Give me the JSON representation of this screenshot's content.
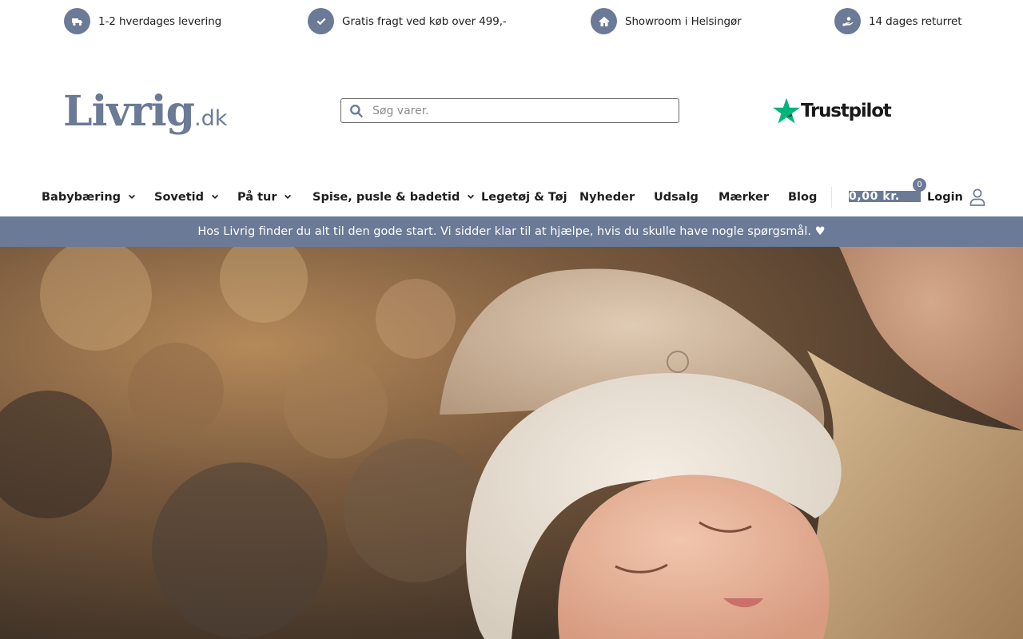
{
  "usp": [
    {
      "icon": "truck-icon",
      "text": "1-2 hverdages levering"
    },
    {
      "icon": "check-icon",
      "text": "Gratis fragt ved køb over 499,-"
    },
    {
      "icon": "home-icon",
      "text": "Showroom i Helsingør"
    },
    {
      "icon": "return-hand-icon",
      "text": "14 dages returret"
    }
  ],
  "header": {
    "logo_main": "Livrig",
    "logo_tld": ".dk",
    "search_placeholder": "Søg varer.",
    "trustpilot_label": "Trustpilot"
  },
  "nav": {
    "items": [
      {
        "label": "Babybæring",
        "has_dropdown": true
      },
      {
        "label": "Sovetid",
        "has_dropdown": true
      },
      {
        "label": "På tur",
        "has_dropdown": true
      },
      {
        "label": "Spise, pusle & badetid",
        "has_dropdown": true
      },
      {
        "label": "Legetøj & Tøj",
        "has_dropdown": false
      },
      {
        "label": "Nyheder",
        "has_dropdown": false
      },
      {
        "label": "Udsalg",
        "has_dropdown": false
      },
      {
        "label": "Mærker",
        "has_dropdown": false
      },
      {
        "label": "Blog",
        "has_dropdown": false
      }
    ],
    "cart_amount": "0,00 kr.",
    "cart_count": "0",
    "login_label": "Login"
  },
  "announcement": "Hos Livrig finder du alt til den gode start. Vi sidder klar til at hjælpe, hvis du skulle have nogle spørgsmål. ♥",
  "colors": {
    "brand": "#6b7a96",
    "trustpilot_green": "#00b67a",
    "text": "#1e1e1e"
  }
}
